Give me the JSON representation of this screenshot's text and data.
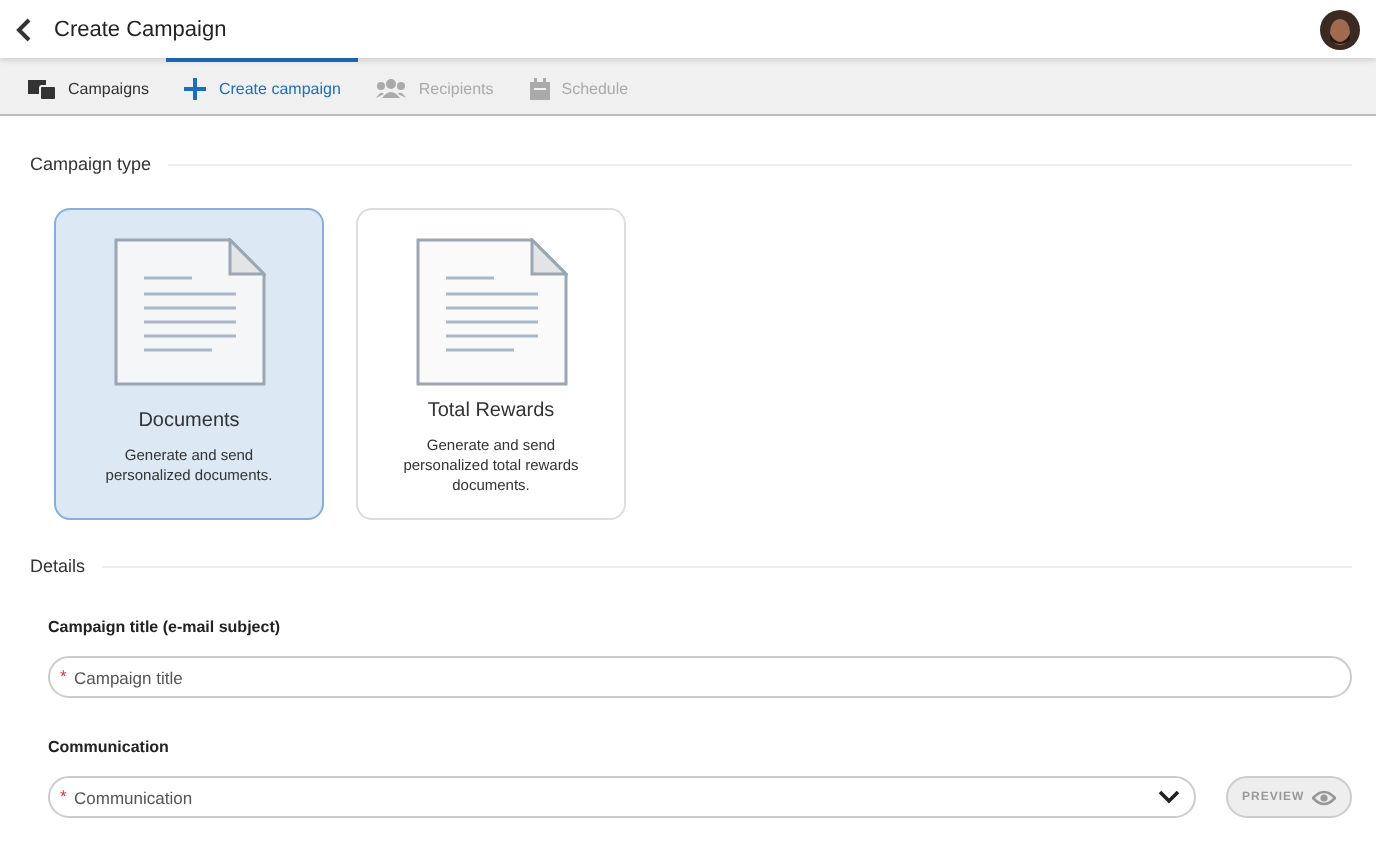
{
  "header": {
    "title": "Create Campaign"
  },
  "tabs": [
    {
      "label": "Campaigns",
      "selected": false,
      "disabled": false
    },
    {
      "label": "Create campaign",
      "selected": true,
      "disabled": false
    },
    {
      "label": "Recipients",
      "selected": false,
      "disabled": true
    },
    {
      "label": "Schedule",
      "selected": false,
      "disabled": true
    }
  ],
  "campaign_type": {
    "heading": "Campaign type",
    "options": [
      {
        "title": "Documents",
        "description": "Generate and send personalized documents.",
        "selected": true
      },
      {
        "title": "Total Rewards",
        "description": "Generate and send personalized total rewards documents.",
        "selected": false
      }
    ]
  },
  "details": {
    "heading": "Details",
    "title_field": {
      "label": "Campaign title (e-mail subject)",
      "marker": "*",
      "placeholder": "Campaign title"
    },
    "communication": {
      "label": "Communication",
      "marker": "*",
      "placeholder": "Communication"
    },
    "preview_button": {
      "label": "PREVIEW",
      "disabled": true
    }
  }
}
